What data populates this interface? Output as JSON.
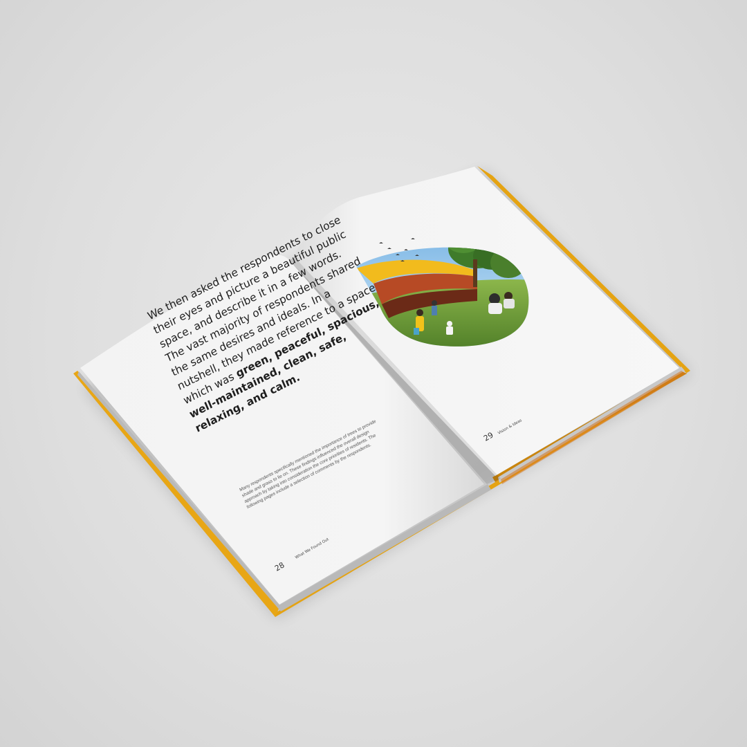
{
  "left_page": {
    "lead_parts": [
      "We then asked the respondents to close their eyes and picture a beautiful public space, and describe it in a few words. The vast majority of respondents shared the same desires and ideals. In a nutshell, they made reference to a space which was ",
      "green, peaceful, spacious, well-maintained, clean, safe, relaxing, and calm.",
      ""
    ],
    "body_note": "Many respondents specifically mentioned the importance of trees to provide shade and grass to lie on. These findings influenced the overall design approach by taking into consideration the core priorities of residents. The following pages include a selection of comments by the respondents.",
    "page_number": "28",
    "section_label": "What We Found Out"
  },
  "right_page": {
    "page_number": "29",
    "section_label": "Vision & Ideas"
  },
  "colors": {
    "background": "#dedede",
    "page": "#f7f7f7",
    "cover_accent": "#e5a312",
    "pavilion_yellow": "#f2bb1d",
    "grass": "#6f9a3a"
  }
}
